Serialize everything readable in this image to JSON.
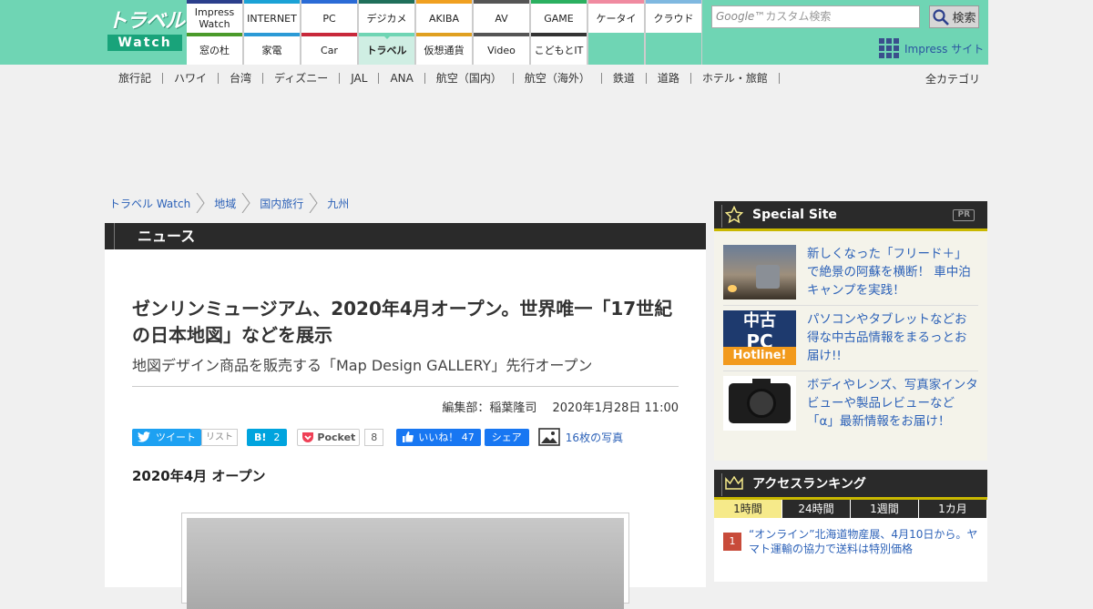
{
  "logo": {
    "line1": "トラベル",
    "line2": "Watch"
  },
  "sitenav": {
    "top": [
      {
        "label": "Impress\nWatch",
        "color": "#2b3f8c"
      },
      {
        "label": "INTERNET",
        "color": "#1ba2d6"
      },
      {
        "label": "PC",
        "color": "#2b6bd6"
      },
      {
        "label": "デジカメ",
        "color": "#1f6f5a"
      },
      {
        "label": "AKIBA",
        "color": "#f0a020"
      },
      {
        "label": "AV",
        "color": "#555"
      },
      {
        "label": "GAME",
        "color": "#2bb060"
      },
      {
        "label": "ケータイ",
        "color": "#f08aa0"
      },
      {
        "label": "クラウド",
        "color": "#7fb8e0"
      }
    ],
    "bottom": [
      {
        "label": "窓の杜",
        "color": "#4a9a2a"
      },
      {
        "label": "家電",
        "color": "#2b9ad6"
      },
      {
        "label": "Car",
        "color": "#c8283a"
      },
      {
        "label": "トラベル",
        "color": "#6fd5b4",
        "active": true
      },
      {
        "label": "仮想通貨",
        "color": "#e0a020"
      },
      {
        "label": "Video",
        "color": "#555"
      },
      {
        "label": "こどもとIT",
        "color": "#333"
      }
    ]
  },
  "search": {
    "placeholder": "カスタム検索",
    "brand": "Google™",
    "button": "検索"
  },
  "impress_site": "Impress サイト",
  "categories": [
    "旅行記",
    "ハワイ",
    "台湾",
    "ディズニー",
    "JAL",
    "ANA",
    "航空（国内）",
    "航空（海外）",
    "鉄道",
    "道路",
    "ホテル・旅館"
  ],
  "all_categories": "全カテゴリ",
  "breadcrumb": [
    "トラベル Watch",
    "地域",
    "国内旅行",
    "九州"
  ],
  "section": "ニュース",
  "article": {
    "title": "ゼンリンミュージアム、2020年4月オープン。世界唯一「17世紀の日本地図」などを展示",
    "subtitle": "地図デザイン商品を販売する「Map Design GALLERY」先行オープン",
    "byline": "編集部：稲葉隆司　 2020年1月28日 11:00",
    "heading": "2020年4月 オープン"
  },
  "social": {
    "tweet": "ツイート",
    "list": "リスト",
    "hatena": "B!",
    "hatena_count": "2",
    "pocket": "Pocket",
    "pocket_count": "8",
    "like": "いいね！ 47",
    "share": "シェア",
    "photos": "16枚の写真"
  },
  "special": {
    "title": "Special Site",
    "pr": "PR",
    "items": [
      {
        "text": "新しくなった「フリード＋」で絶景の阿蘇を横断！ 車中泊キャンプを実践！"
      },
      {
        "text": "パソコンやタブレットなどお得な中古品情報をまるっとお届け!!",
        "logo": [
          "中古",
          "PC",
          "Hotline!"
        ]
      },
      {
        "text": "ボディやレンズ、写真家インタビューや製品レビューなど「α」最新情報をお届け！"
      }
    ]
  },
  "ranking": {
    "title": "アクセスランキング",
    "tabs": [
      "1時間",
      "24時間",
      "1週間",
      "1カ月"
    ],
    "active_tab": 0,
    "items": [
      {
        "rank": "1",
        "text": "“オンライン”北海道物産展、4月10日から。ヤマト運輸の協力で送料は特別価格"
      }
    ]
  }
}
